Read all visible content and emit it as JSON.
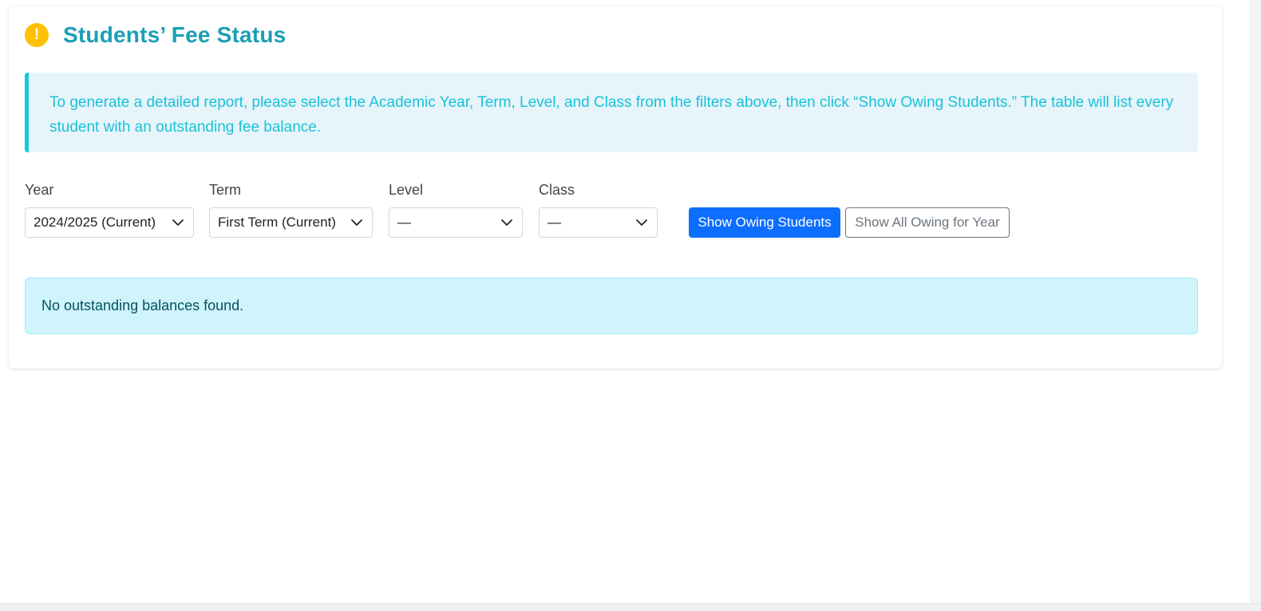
{
  "header": {
    "icon": "exclamation-circle-icon",
    "icon_glyph": "!",
    "icon_color": "#ffc107",
    "title": "Students’ Fee Status",
    "title_color": "#1a9fb5"
  },
  "info": {
    "text": "To generate a detailed report, please select the Academic Year, Term, Level, and Class from the filters above, then click “Show Owing Students.” The table will list every student with an outstanding fee balance."
  },
  "filters": {
    "year": {
      "label": "Year",
      "value": "2024/2025 (Current)"
    },
    "term": {
      "label": "Term",
      "value": "First Term (Current)"
    },
    "level": {
      "label": "Level",
      "value": "—"
    },
    "class": {
      "label": "Class",
      "value": "—"
    }
  },
  "buttons": {
    "show_owing": "Show Owing Students",
    "show_all_owing": "Show All Owing for Year",
    "primary_color": "#0d6efd"
  },
  "result": {
    "message": "No outstanding balances found."
  }
}
